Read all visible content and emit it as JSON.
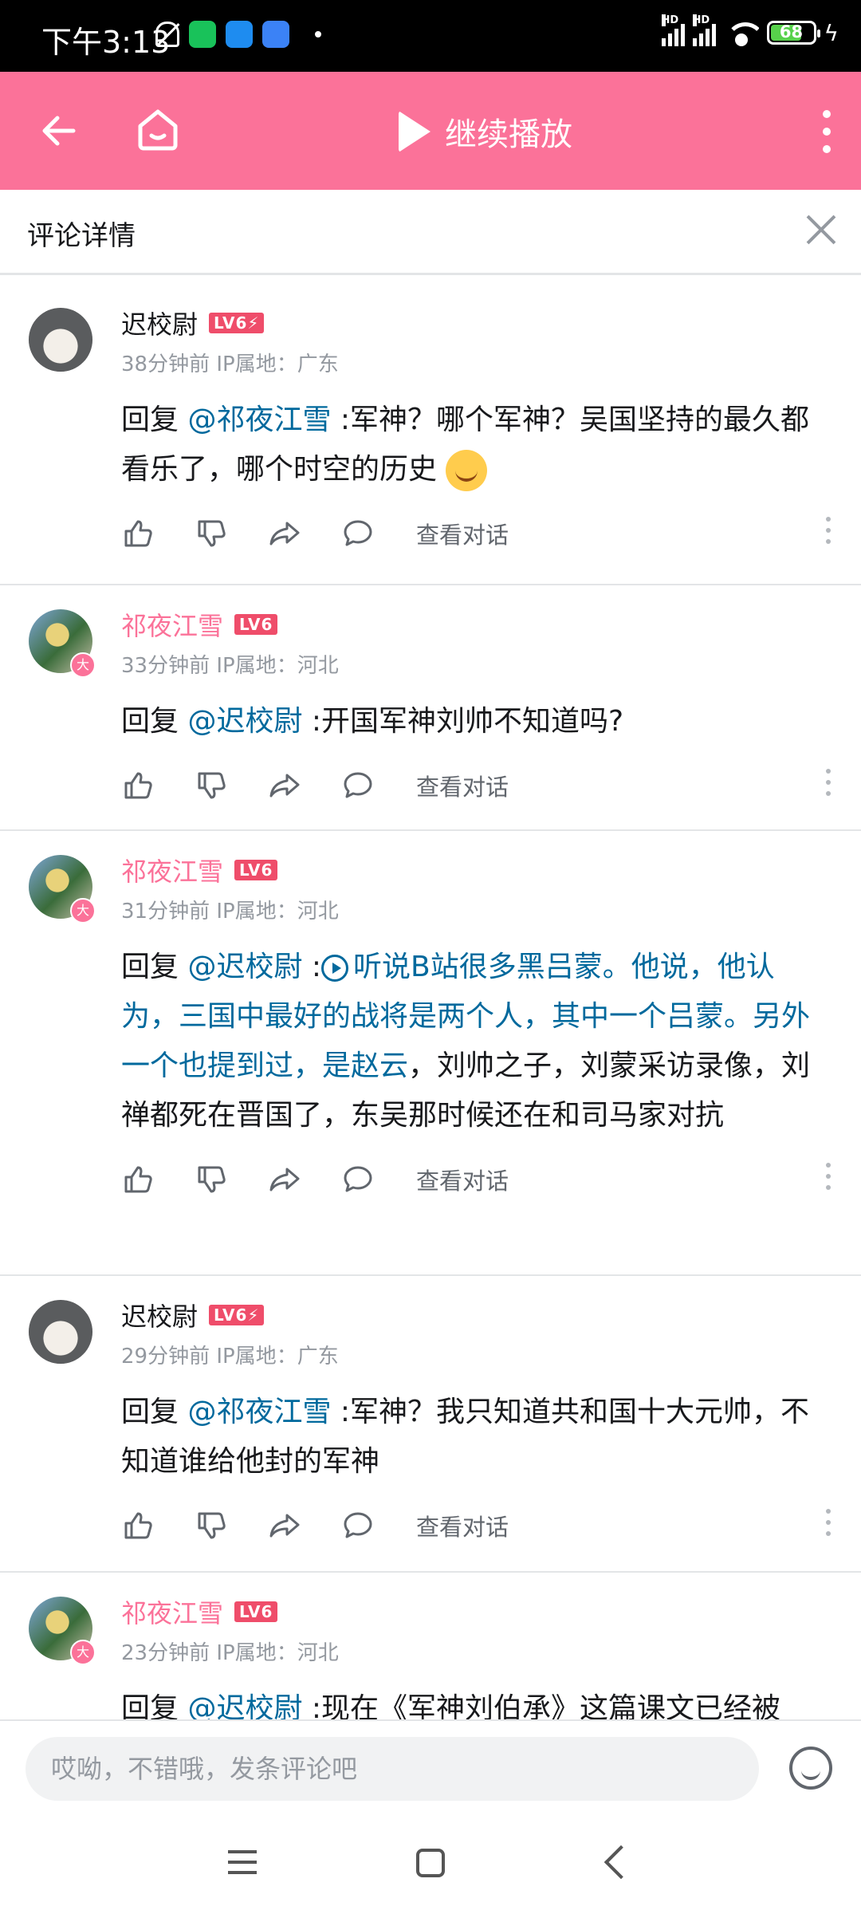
{
  "status_bar": {
    "time": "下午3:13",
    "battery": "68",
    "battery_level": 0.68
  },
  "header": {
    "continue_label": "继续播放"
  },
  "titlebar": {
    "title": "评论详情"
  },
  "actions": {
    "view_dialog": "查看对话"
  },
  "comments": [
    {
      "name": "迟校尉",
      "level": "LV6⚡",
      "meta": "38分钟前 IP属地：广东",
      "reply_prefix": "回复 ",
      "mention": "@祁夜江雪",
      "text": " :军神？哪个军神？吴国坚持的最久都看乐了，哪个时空的历史"
    },
    {
      "name": "祁夜江雪",
      "level": "LV6",
      "meta": "33分钟前 IP属地：河北",
      "badge": "大",
      "reply_prefix": "回复 ",
      "mention": "@迟校尉",
      "text": " :开国军神刘帅不知道吗?"
    },
    {
      "name": "祁夜江雪",
      "level": "LV6",
      "meta": "31分钟前 IP属地：河北",
      "badge": "大",
      "reply_prefix": "回复 ",
      "mention": "@迟校尉",
      "sep": " :",
      "link": "听说B站很多黑吕蒙。他说，他认为，三国中最好的战将是两个人，其中一个吕蒙。另外一个也提到过，是赵云",
      "text": "，刘帅之子，刘蒙采访录像，刘禅都死在晋国了，东吴那时候还在和司马家对抗"
    },
    {
      "name": "迟校尉",
      "level": "LV6⚡",
      "meta": "29分钟前 IP属地：广东",
      "reply_prefix": "回复 ",
      "mention": "@祁夜江雪",
      "text": " :军神？我只知道共和国十大元帅，不知道谁给他封的军神"
    },
    {
      "name": "祁夜江雪",
      "level": "LV6",
      "meta": "23分钟前 IP属地：河北",
      "badge": "大",
      "reply_prefix": "回复 ",
      "mention": "@迟校尉",
      "text": " :现在《军神刘伯承》这篇课文已经被"
    }
  ],
  "input": {
    "placeholder": "哎呦，不错哦，发条评论吧"
  }
}
